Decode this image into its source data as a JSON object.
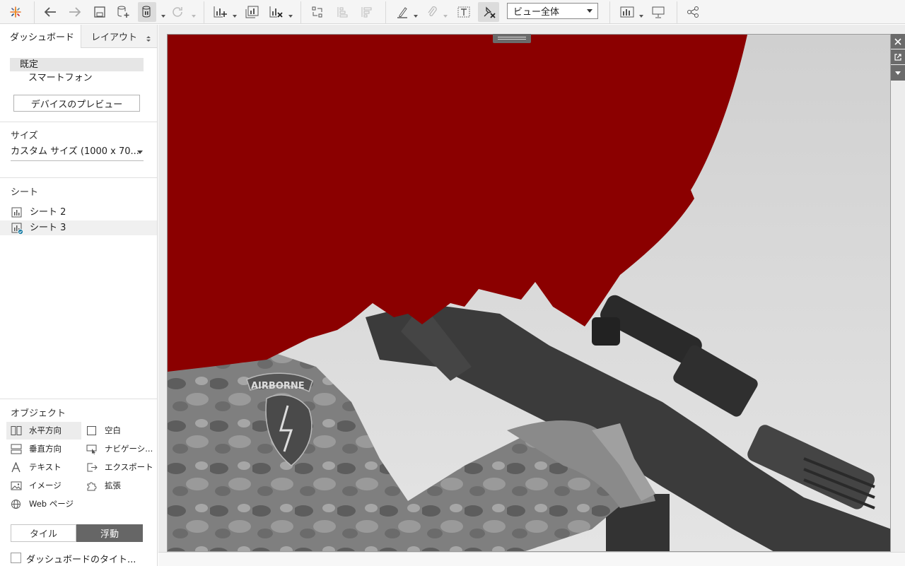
{
  "toolbar": {
    "fit_select": "ビュー全体",
    "icons": [
      "tableau-logo-icon",
      "undo-icon",
      "redo-icon",
      "save-icon",
      "new-datasource-icon",
      "pause-updates-icon",
      "refresh-icon",
      "new-worksheet-icon",
      "duplicate-sheet-icon",
      "clear-sheet-icon",
      "swap-icon",
      "sort-ascending-icon",
      "sort-descending-icon",
      "highlight-icon",
      "attach-icon",
      "label-icon",
      "fix-axes-icon",
      "show-me-icon",
      "presentation-icon",
      "share-icon"
    ]
  },
  "left_panel": {
    "tabs": {
      "dashboard": "ダッシュボード",
      "layout": "レイアウト"
    },
    "devices": {
      "default": "既定",
      "phone": "スマートフォン"
    },
    "device_preview_button": "デバイスのプレビュー",
    "size": {
      "title": "サイズ",
      "value": "カスタム サイズ (1000 x 70..."
    },
    "sheets": {
      "title": "シート",
      "items": [
        {
          "label": "シート 2"
        },
        {
          "label": "シート 3"
        }
      ]
    },
    "objects": {
      "title": "オブジェクト",
      "items": {
        "horizontal": "水平方向",
        "blank": "空白",
        "vertical": "垂直方向",
        "navigation": "ナビゲーシ...",
        "text": "テキスト",
        "export": "エクスポート",
        "image": "イメージ",
        "extension": "拡張",
        "webpage": "Web ページ"
      }
    },
    "mode": {
      "tiled": "タイル",
      "floating": "浮動"
    },
    "show_title": "ダッシュボードのタイト..."
  },
  "canvas": {
    "colors": {
      "accent": "#8b0000",
      "sky": "#d9d9d9"
    },
    "patch_text": "AIRBORNE"
  }
}
